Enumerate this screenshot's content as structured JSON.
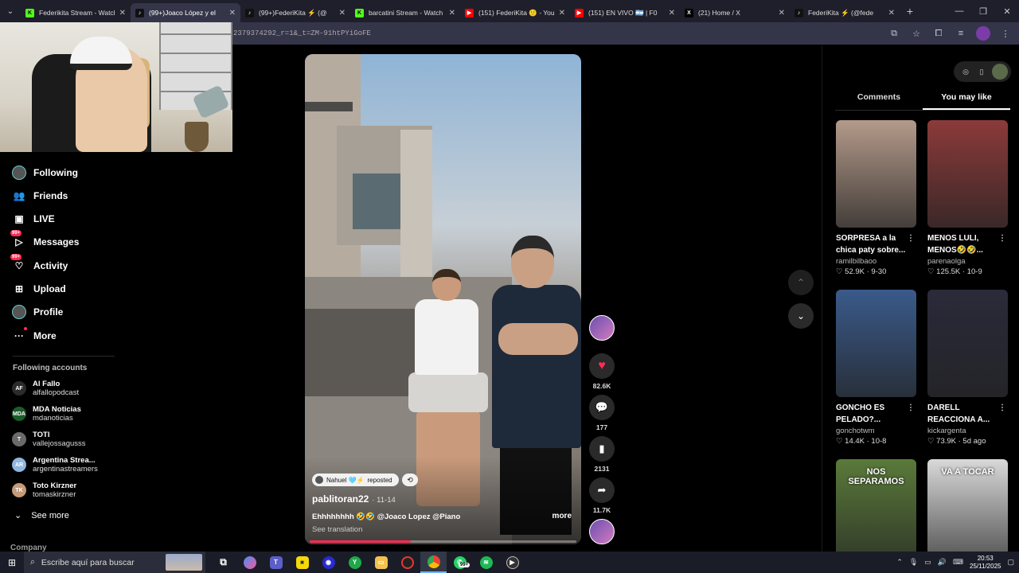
{
  "browser": {
    "tabs": [
      {
        "title": "Federikita Stream - Watch",
        "fav": "K",
        "favColor": "#53fc18",
        "active": false
      },
      {
        "title": "(99+)Joaco López y el",
        "fav": "♪",
        "favColor": "#111111",
        "active": true
      },
      {
        "title": "(99+)FederiKita ⚡ (@",
        "fav": "♪",
        "favColor": "#111111",
        "active": false
      },
      {
        "title": "barcatini Stream - Watch",
        "fav": "K",
        "favColor": "#53fc18",
        "active": false
      },
      {
        "title": "(151) FederiKita 🙂 - You",
        "fav": "▶",
        "favColor": "#ff0000",
        "active": false
      },
      {
        "title": "(151) EN VIVO 🇦🇷 | F0",
        "fav": "▶",
        "favColor": "#ff0000",
        "active": false
      },
      {
        "title": "(21) Home / X",
        "fav": "X",
        "favColor": "#000000",
        "active": false
      },
      {
        "title": "FederiKita ⚡ (@fede",
        "fav": "♪",
        "favColor": "#111111",
        "active": false
      }
    ],
    "url": "2379374292_r=1&_t=ZM-91htPYiGoFE"
  },
  "sidebar": {
    "nav": [
      {
        "label": "Following",
        "icon": "following-avatar-icon"
      },
      {
        "label": "Friends",
        "icon": "friends-icon"
      },
      {
        "label": "LIVE",
        "icon": "live-icon"
      },
      {
        "label": "Messages",
        "icon": "messages-icon",
        "badge": "99+"
      },
      {
        "label": "Activity",
        "icon": "activity-icon",
        "badge": "99+"
      },
      {
        "label": "Upload",
        "icon": "upload-icon"
      },
      {
        "label": "Profile",
        "icon": "profile-avatar-icon"
      },
      {
        "label": "More",
        "icon": "more-icon"
      }
    ],
    "following_title": "Following accounts",
    "accounts": [
      {
        "name": "Al Fallo",
        "handle": "alfallopodcast",
        "color": "#2b2b2b",
        "glyph": "AF"
      },
      {
        "name": "MDA Noticias",
        "handle": "mdanoticias",
        "color": "#1a5c2a",
        "glyph": "MDA"
      },
      {
        "name": "TOTI",
        "handle": "vallejossagusss",
        "color": "#6a6a6a",
        "glyph": "T"
      },
      {
        "name": "Argentina Strea...",
        "handle": "argentinastreamers",
        "color": "#8fb7e0",
        "glyph": "AR"
      },
      {
        "name": "Toto Kirzner",
        "handle": "tomaskirzner",
        "color": "#c49a7a",
        "glyph": "TK"
      }
    ],
    "see_more": "See more",
    "company": "Company"
  },
  "video": {
    "repost_user": "Nahuel 🩵⚡",
    "repost_label": "reposted",
    "author": "pablitoran22",
    "date": "· 11-14",
    "caption": "Ehhhhhhhh 🤣🤣 @Joaco Lopez @Piano",
    "more": "more",
    "translation": "See translation",
    "progress": 0.38
  },
  "actions": {
    "likes": "82.6K",
    "comments": "177",
    "saves": "2131",
    "shares": "11.7K"
  },
  "right_panel": {
    "tabs": [
      "Comments",
      "You may like"
    ],
    "active_tab": 1,
    "cards": [
      {
        "title": "SORPRESA a la chica paty sobre...",
        "user": "ramilbilbaoo",
        "meta": "♡ 52.9K · 9-30",
        "bg": "#b49a8a"
      },
      {
        "title": "MENOS LULI, MENOS🤣🤣...",
        "user": "parenaolga",
        "meta": "♡ 125.5K · 10-9",
        "bg": "#8c3a3a"
      },
      {
        "title": "GONCHO ES PELADO?...",
        "user": "gonchotwm",
        "meta": "♡ 14.4K · 10-8",
        "bg": "#3a5a8a"
      },
      {
        "title": "DARELL REACCIONA A...",
        "user": "kickargenta",
        "meta": "♡ 73.9K · 5d ago",
        "bg": "#2a2a3a"
      },
      {
        "title": "",
        "user": "",
        "meta": "",
        "bg": "#5a7a3a",
        "overlay": "NOS SEPARAMOS"
      },
      {
        "title": "",
        "user": "",
        "meta": "",
        "bg": "#d9d9d9",
        "overlay": "VA A TOCAR"
      }
    ]
  },
  "taskbar": {
    "search_placeholder": "Escribe aquí para buscar",
    "time": "20:53",
    "date": "25/11/2025",
    "badge": "99+"
  }
}
